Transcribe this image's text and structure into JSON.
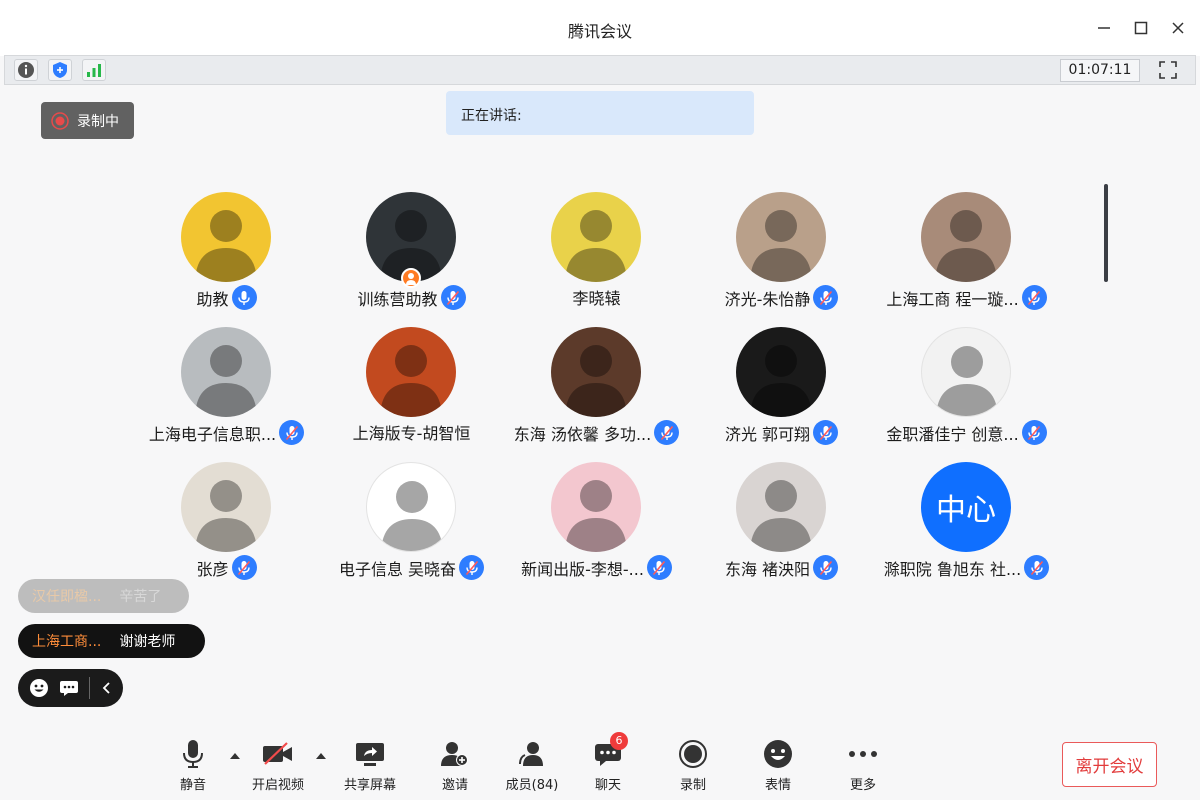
{
  "window": {
    "title": "腾讯会议"
  },
  "infobar": {
    "timer": "01:07:11"
  },
  "recording": {
    "label": "录制中"
  },
  "speaking": {
    "label": "正在讲话:"
  },
  "participants": [
    {
      "name": "助教",
      "mic": "on",
      "avatar_color": "#f2c531"
    },
    {
      "name": "训练营助教",
      "mic": "muted",
      "avatar_color": "#2f3438",
      "host": true
    },
    {
      "name": "李晓辕",
      "mic": "none",
      "avatar_color": "#e9d24a"
    },
    {
      "name": "济光-朱怡静",
      "mic": "muted",
      "avatar_color": "#b9a08a"
    },
    {
      "name": "上海工商 程一璇...",
      "mic": "muted",
      "avatar_color": "#a88b79"
    },
    {
      "name": "上海电子信息职...",
      "mic": "muted",
      "avatar_color": "#b8bcbf"
    },
    {
      "name": "上海版专-胡智恒",
      "mic": "none",
      "avatar_color": "#c24a1f"
    },
    {
      "name": "东海 汤依馨 多功...",
      "mic": "muted",
      "avatar_color": "#5c3a2a"
    },
    {
      "name": "济光 郭可翔",
      "mic": "muted",
      "avatar_color": "#1a1a1a"
    },
    {
      "name": "金职潘佳宁 创意...",
      "mic": "muted",
      "avatar_color": "#f2f2f2"
    },
    {
      "name": "张彦",
      "mic": "muted",
      "avatar_color": "#e3ddd3"
    },
    {
      "name": "电子信息 吴晓奋",
      "mic": "muted",
      "avatar_color": "#ffffff"
    },
    {
      "name": "新闻出版-李想-...",
      "mic": "muted",
      "avatar_color": "#f3c7cf"
    },
    {
      "name": "东海 褚泱阳",
      "mic": "muted",
      "avatar_color": "#d9d4d2"
    },
    {
      "name": "滁职院 鲁旭东 社...",
      "mic": "muted",
      "avatar_color": "#0f6fff",
      "avatar_text": "中心"
    }
  ],
  "chat": {
    "faded": {
      "who": "汉任即楹...",
      "text": "辛苦了"
    },
    "active": {
      "who": "上海工商...",
      "text": "谢谢老师"
    }
  },
  "toolbar": {
    "mute": "静音",
    "video": "开启视频",
    "share": "共享屏幕",
    "invite": "邀请",
    "members": "成员(84)",
    "chat": "聊天",
    "chat_badge": "6",
    "record": "录制",
    "emoji": "表情",
    "more": "更多",
    "leave": "离开会议"
  },
  "colors": {
    "accent": "#2e7dff",
    "danger": "#e23c3c",
    "signal": "#27b84a"
  }
}
